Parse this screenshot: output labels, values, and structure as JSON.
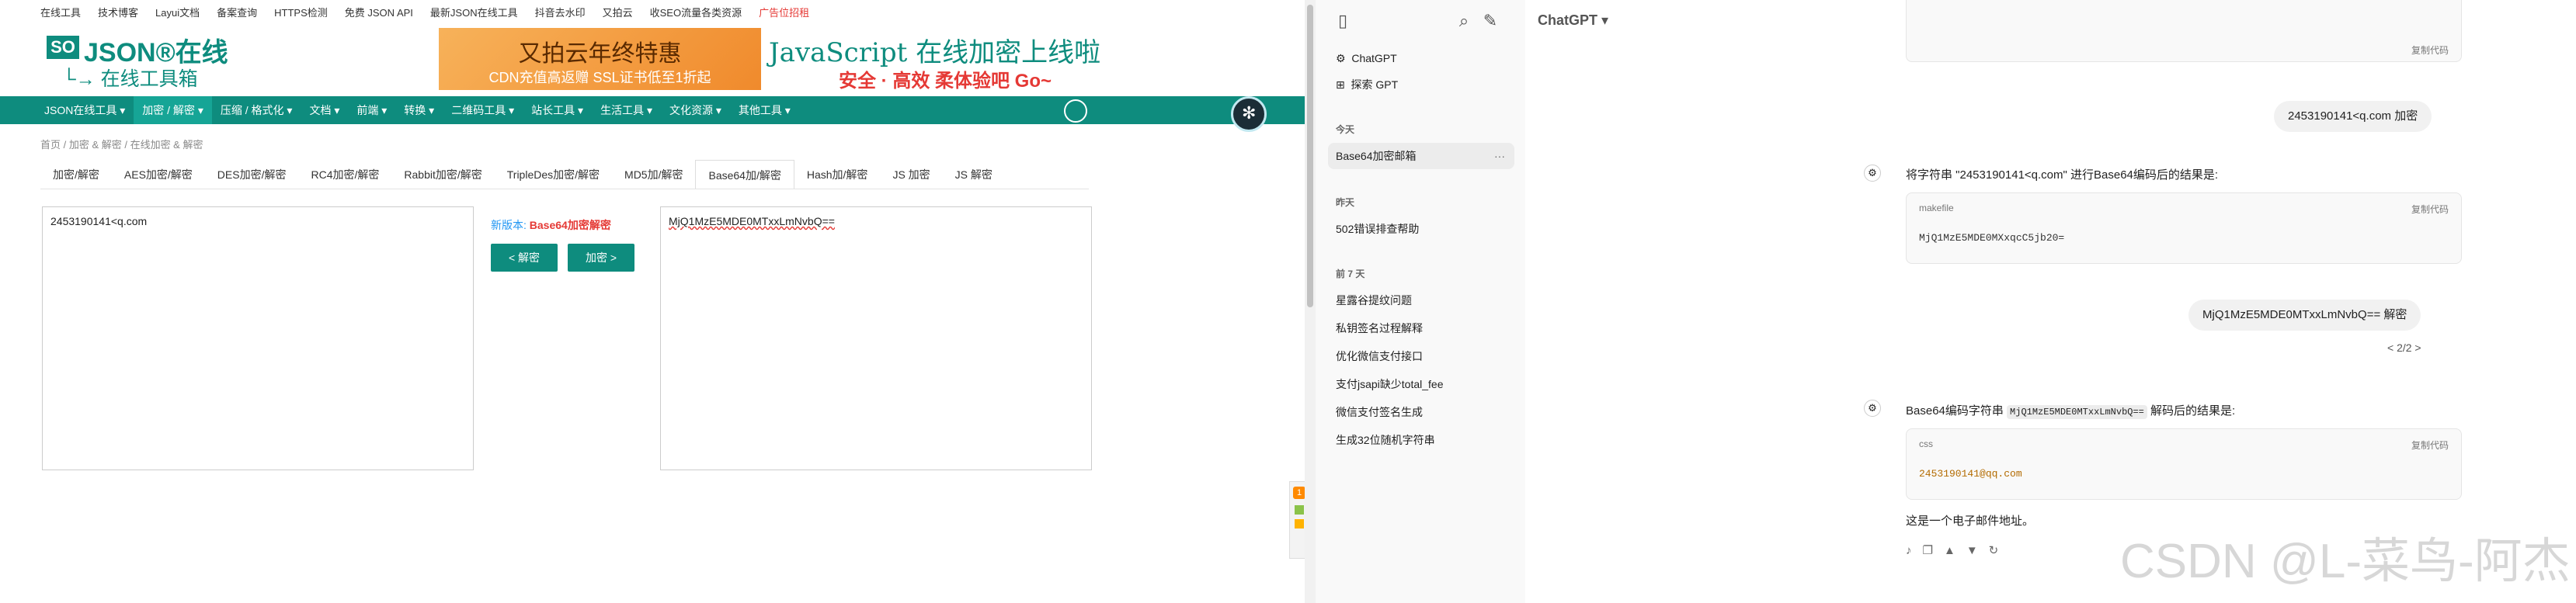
{
  "site": {
    "top_links": [
      "在线工具",
      "技术博客",
      "Layui文档",
      "备案查询",
      "HTTPS检测",
      "免费 JSON API",
      "最新JSON在线工具",
      "抖音去水印",
      "又拍云",
      "收SEO流量各类资源",
      "广告位招租"
    ],
    "logo_box": "SO",
    "logo_text": "JSON®在线",
    "logo_sub": "└→ 在线工具箱",
    "banner1_title": "又拍云年终特惠",
    "banner1_sub": "CDN充值高返赠 SSL证书低至1折起",
    "banner2_title": "JavaScript 在线加密上线啦",
    "banner2_sub": "安全 · 高效 柔体验吧 Go~",
    "nav": [
      "JSON在线工具 ▾",
      "加密 / 解密 ▾",
      "压缩 / 格式化 ▾",
      "文档 ▾",
      "前端 ▾",
      "转换 ▾",
      "二维码工具 ▾",
      "站长工具 ▾",
      "生活工具 ▾",
      "文化资源 ▾",
      "其他工具 ▾"
    ],
    "breadcrumb": "首页 / 加密 & 解密 / 在线加密 & 解密",
    "tabs": [
      "加密/解密",
      "AES加密/解密",
      "DES加密/解密",
      "RC4加密/解密",
      "Rabbit加密/解密",
      "TripleDes加密/解密",
      "MD5加/解密",
      "Base64加/解密",
      "Hash加/解密",
      "JS 加密",
      "JS 解密"
    ],
    "input_text": "2453190141<q.com",
    "output_text": "MjQ1MzE5MDE0MTxxLmNvbQ==",
    "version_label": "新版本:",
    "version_value": "Base64加密解密",
    "decode_btn": "< 解密",
    "encode_btn": "加密 >",
    "side_widget_num": "1"
  },
  "sidebar": {
    "items_top": [
      "ChatGPT",
      "探索 GPT"
    ],
    "section_today": "今天",
    "today": [
      "Base64加密邮箱"
    ],
    "section_yesterday": "昨天",
    "yesterday": [
      "502错误排查帮助"
    ],
    "section_week": "前 7 天",
    "week": [
      "星露谷提纹问题",
      "私钥签名过程解释",
      "优化微信支付接口",
      "支付jsapi缺少total_fee",
      "微信支付签名生成",
      "生成32位随机字符串"
    ],
    "more_icon": "···"
  },
  "chat": {
    "model": "ChatGPT ▾",
    "copy_label": "复制代码",
    "user1": "2453190141<q.com  加密",
    "assist1": "将字符串 \"2453190141<q.com\" 进行Base64编码后的结果是:",
    "code1_lang": "makefile",
    "code1_body": "MjQ1MzE5MDE0MXxqcC5jb20=",
    "user2": "MjQ1MzE5MDE0MTxxLmNvbQ==  解密",
    "pager": "< 2/2 >",
    "assist2_pre": "Base64编码字符串",
    "assist2_code": "MjQ1MzE5MDE0MTxxLmNvbQ==",
    "assist2_post": "解码后的结果是:",
    "code2_lang": "css",
    "code2_body": "2453190141@qq.com",
    "assist3": "这是一个电子邮件地址。",
    "watermark": "CSDN @L-菜鸟-阿杰"
  },
  "colors": {
    "teal": "#0e8c7e",
    "accent_red": "#e53935",
    "sidebar_bg": "#f9f9f9"
  }
}
